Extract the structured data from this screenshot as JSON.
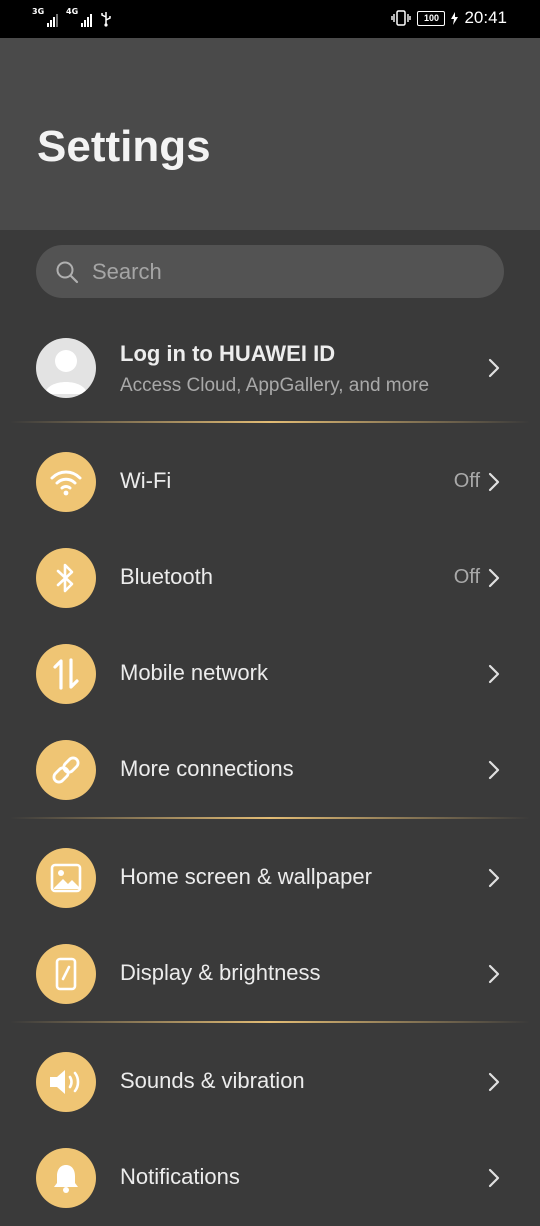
{
  "status_bar": {
    "sim1_type": "3G",
    "sim2_type": "4G",
    "usb_icon": "usb-icon",
    "vibrate_icon": "vibrate-icon",
    "battery": "100",
    "time": "20:41"
  },
  "header": {
    "title": "Settings"
  },
  "search": {
    "placeholder": "Search",
    "icon": "search-icon"
  },
  "account": {
    "title": "Log in to HUAWEI ID",
    "subtitle": "Access Cloud, AppGallery, and more",
    "icon": "avatar-icon"
  },
  "settings_items": [
    {
      "label": "Wi-Fi",
      "status": "Off",
      "icon": "wifi-icon"
    },
    {
      "label": "Bluetooth",
      "status": "Off",
      "icon": "bluetooth-icon"
    },
    {
      "label": "Mobile network",
      "status": "",
      "icon": "mobile-data-icon"
    },
    {
      "label": "More connections",
      "status": "",
      "icon": "link-icon"
    },
    {
      "label": "Home screen & wallpaper",
      "status": "",
      "icon": "image-icon"
    },
    {
      "label": "Display & brightness",
      "status": "",
      "icon": "display-icon"
    },
    {
      "label": "Sounds & vibration",
      "status": "",
      "icon": "speaker-icon"
    },
    {
      "label": "Notifications",
      "status": "",
      "icon": "bell-icon"
    }
  ],
  "colors": {
    "background": "#3a3a3a",
    "header": "#4a4a4a",
    "accent": "#efc574",
    "divider": "#ebc378",
    "text": "#ececec",
    "secondary_text": "#a9a9a9"
  }
}
